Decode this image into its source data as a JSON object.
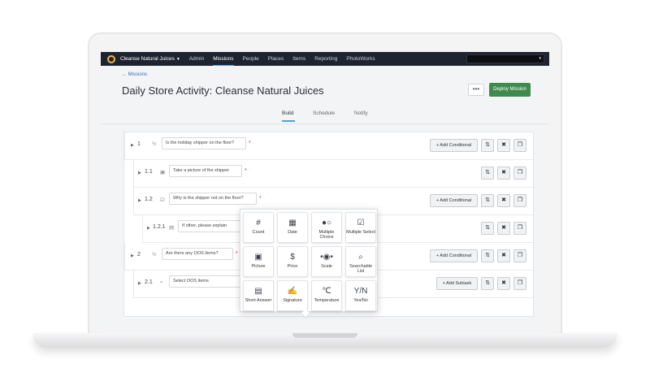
{
  "nav": {
    "org_name": "Cleanse Natural Juices",
    "items": [
      "Admin",
      "Missions",
      "People",
      "Places",
      "Items",
      "Reporting",
      "PhotoWorks"
    ],
    "active": "Missions"
  },
  "header": {
    "back_label": "← Missions",
    "title": "Daily Store Activity: Cleanse Natural Juices",
    "more_label": "•••",
    "deploy_label": "Deploy Mission"
  },
  "tabs": [
    "Build",
    "Schedule",
    "Notify"
  ],
  "active_tab": "Build",
  "rows": [
    {
      "number": "1",
      "type_icon": "yes-no-icon",
      "type_glyph": "½",
      "question": "Is the holiday shipper on the floor?",
      "action": "+ Add Conditional"
    },
    {
      "number": "1.1",
      "type_icon": "camera-icon",
      "type_glyph": "▣",
      "question": "Take a picture of the shipper",
      "action": ""
    },
    {
      "number": "1.2",
      "type_icon": "checkbox-icon",
      "type_glyph": "☑",
      "question": "Why is the shipper not on the floor?",
      "action": "+ Add Conditional"
    },
    {
      "number": "1.2.1",
      "type_icon": "short-answer-icon",
      "type_glyph": "▤",
      "question": "If other, please explain",
      "action": ""
    },
    {
      "number": "2",
      "type_icon": "yes-no-icon",
      "type_glyph": "½",
      "question": "Are there any OOS items?",
      "action": "+ Add Conditional"
    },
    {
      "number": "2.1",
      "type_icon": "searchable-list-icon",
      "type_glyph": "⌕",
      "question": "Select OOS items",
      "action": "+ Add Subtask"
    }
  ],
  "row_buttons": {
    "move": "⇅",
    "delete": "✖",
    "copy": "❐"
  },
  "question_types": [
    {
      "label": "Count",
      "icon": "hash-icon",
      "glyph": "#"
    },
    {
      "label": "Date",
      "icon": "calendar-icon",
      "glyph": "▦"
    },
    {
      "label": "Multiple Choice",
      "icon": "radio-icon",
      "glyph": "●○"
    },
    {
      "label": "Multiple Select",
      "icon": "checkbox-icon",
      "glyph": "☑"
    },
    {
      "label": "Picture",
      "icon": "camera-icon",
      "glyph": "▣"
    },
    {
      "label": "Price",
      "icon": "dollar-icon",
      "glyph": "$"
    },
    {
      "label": "Scale",
      "icon": "slider-icon",
      "glyph": "•◉•"
    },
    {
      "label": "Searchable List",
      "icon": "search-list-icon",
      "glyph": "⌕"
    },
    {
      "label": "Short Answer",
      "icon": "text-icon",
      "glyph": "▤"
    },
    {
      "label": "Signature",
      "icon": "signature-icon",
      "glyph": "✍"
    },
    {
      "label": "Temperature",
      "icon": "thermometer-icon",
      "glyph": "℃"
    },
    {
      "label": "Yes/No",
      "icon": "yes-no-icon",
      "glyph": "Y/N"
    }
  ]
}
